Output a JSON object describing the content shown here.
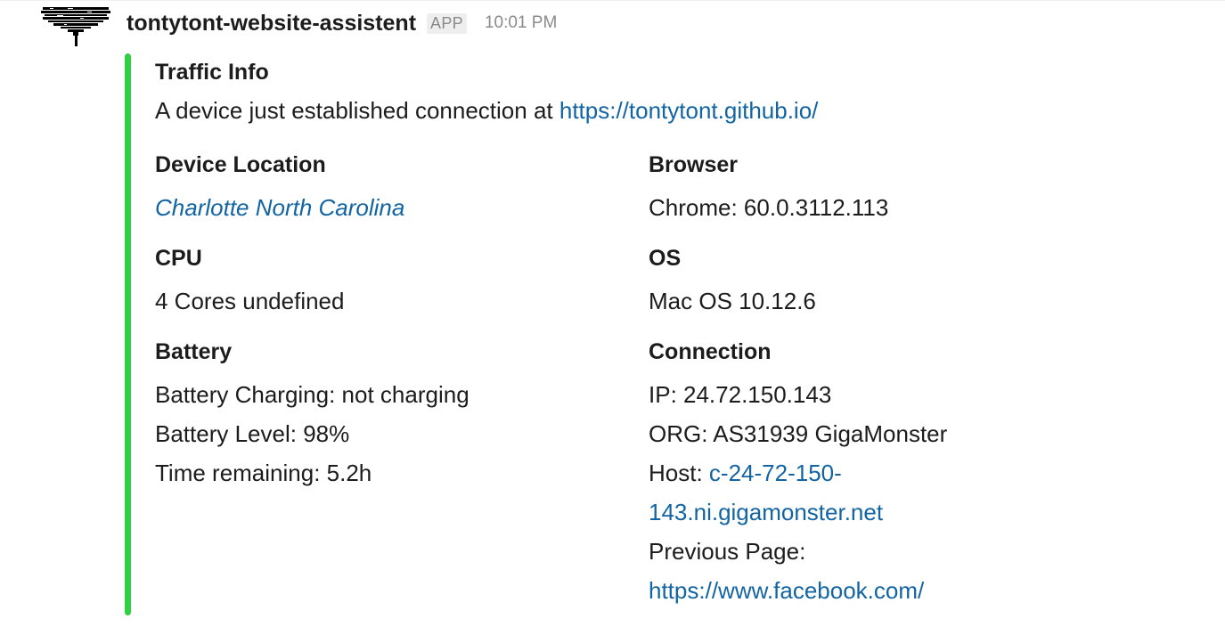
{
  "message": {
    "sender": "tontytont-website-assistent",
    "app_badge": "APP",
    "timestamp": "10:01 PM",
    "avatar_icon": "pixel-art-avatar-icon"
  },
  "attachment": {
    "bar_color": "#2fd041",
    "title": "Traffic Info",
    "text_prefix": "A device just established connection at ",
    "text_link": "https://tontytont.github.io/",
    "fields": {
      "location": {
        "title": "Device Location",
        "value": "Charlotte North Carolina"
      },
      "browser": {
        "title": "Browser",
        "value": "Chrome: 60.0.3112.113"
      },
      "cpu": {
        "title": "CPU",
        "value": "4 Cores undefined"
      },
      "os": {
        "title": "OS",
        "value": "Mac OS 10.12.6"
      },
      "battery": {
        "title": "Battery",
        "lines": [
          "Battery Charging: not charging",
          "Battery Level: 98%",
          "Time remaining: 5.2h"
        ]
      },
      "connection": {
        "title": "Connection",
        "ip": "IP: 24.72.150.143",
        "org": "ORG: AS31939 GigaMonster",
        "host_label": "Host: ",
        "host_link_part1": "c-24-72-150-",
        "host_link_part2": "143.ni.gigamonster.net",
        "previous_page_label": "Previous Page:",
        "previous_page_link": "https://www.facebook.com/"
      }
    }
  }
}
